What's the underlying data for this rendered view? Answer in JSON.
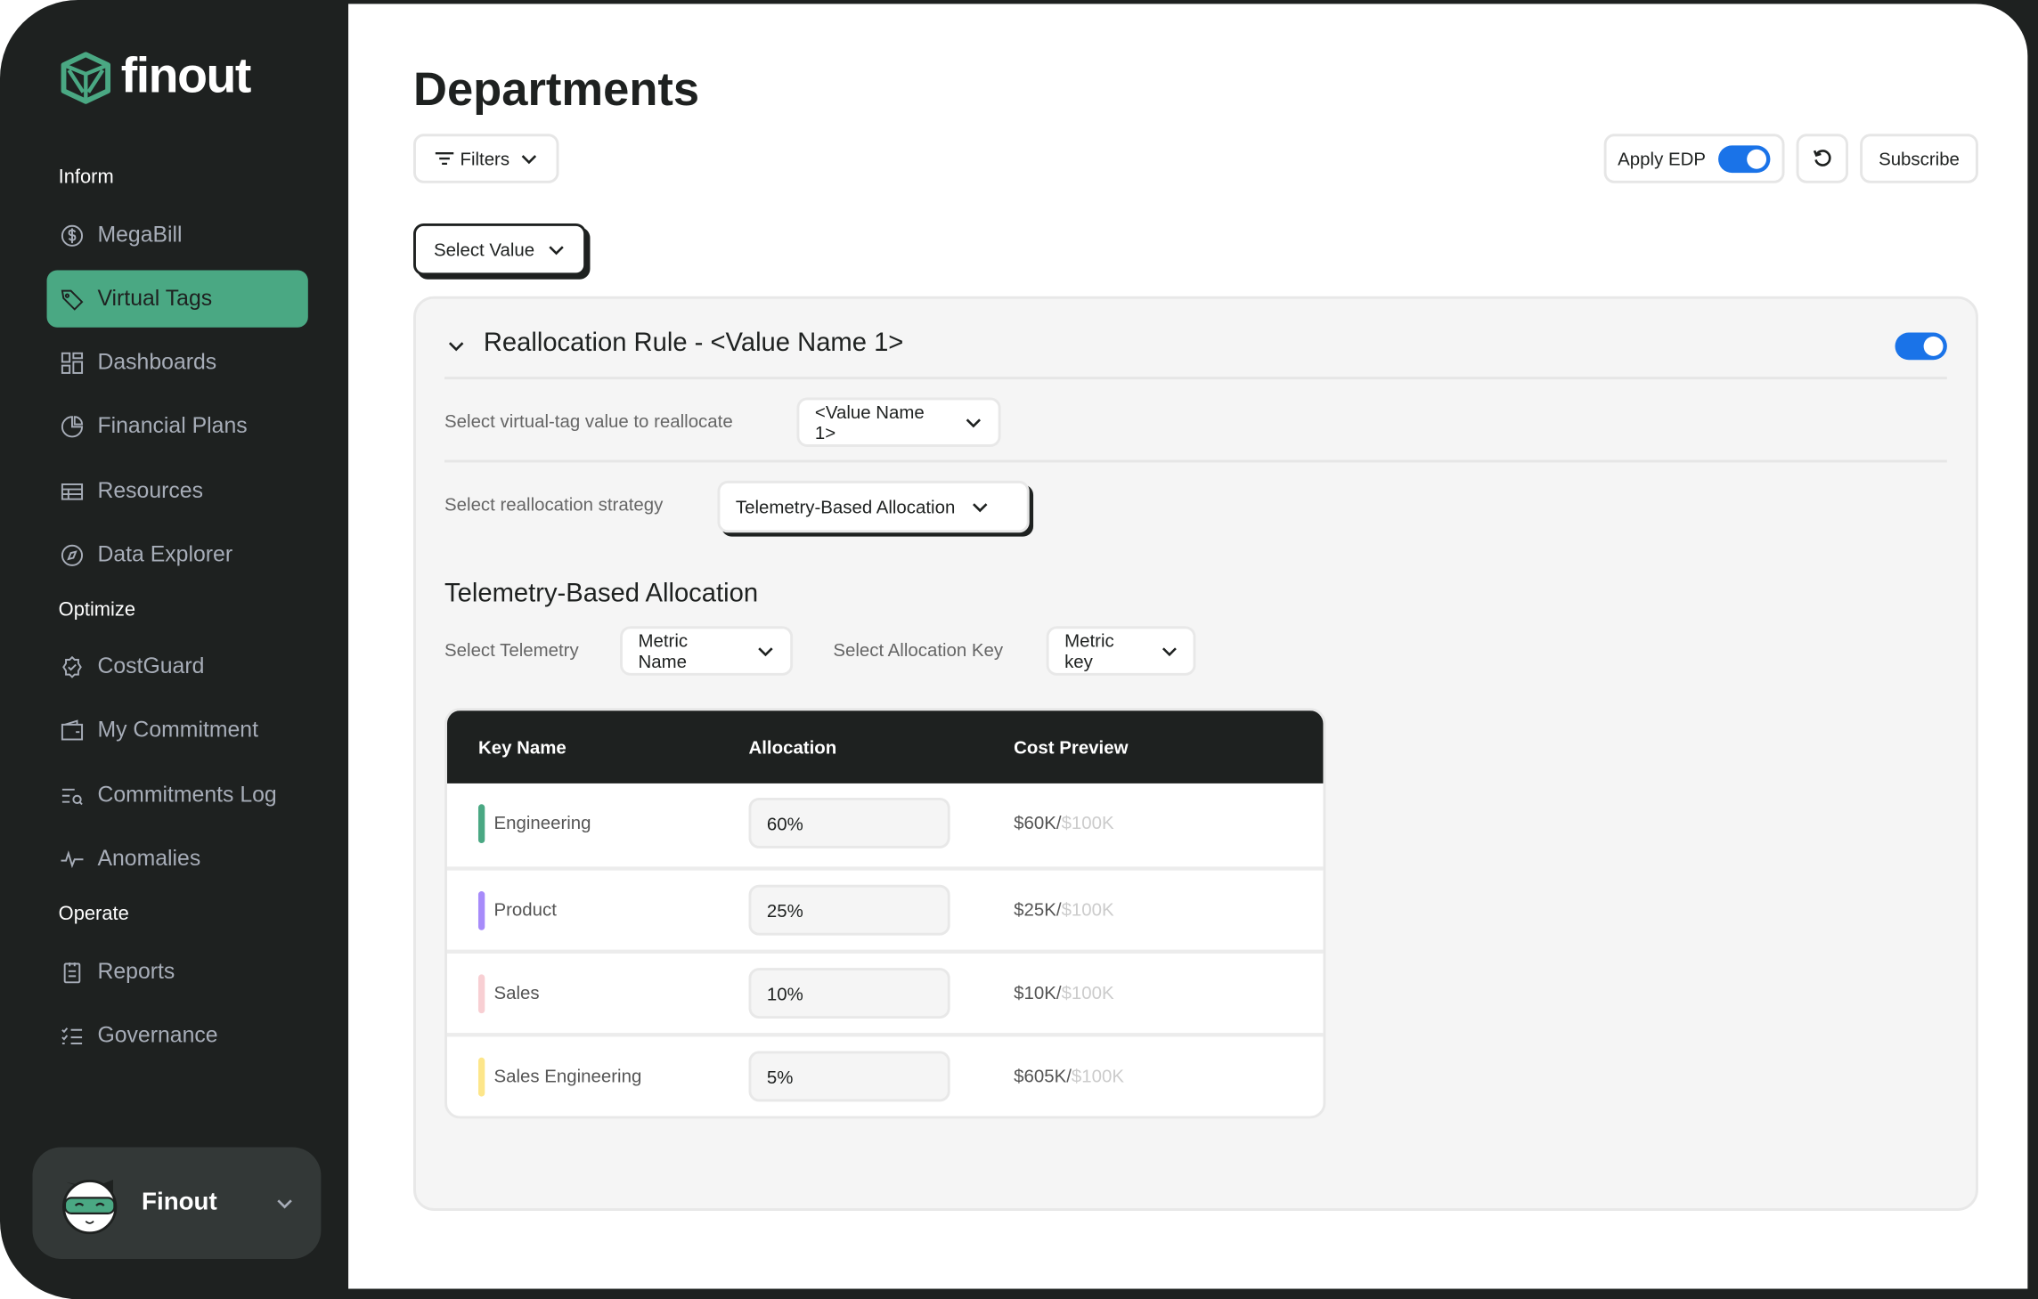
{
  "brand": {
    "name": "finout",
    "colors": {
      "accent": "#4aa883",
      "toggle": "#1a73e8",
      "sidebar": "#1e2120"
    }
  },
  "sidebar": {
    "sections": [
      {
        "label": "Inform",
        "items": [
          {
            "label": "MegaBill",
            "icon": "dollar-circle-icon"
          },
          {
            "label": "Virtual Tags",
            "icon": "tag-icon",
            "active": true
          },
          {
            "label": "Dashboards",
            "icon": "dashboard-icon"
          },
          {
            "label": "Financial Plans",
            "icon": "pie-chart-icon"
          },
          {
            "label": "Resources",
            "icon": "table-icon"
          },
          {
            "label": "Data Explorer",
            "icon": "compass-icon"
          }
        ]
      },
      {
        "label": "Optimize",
        "items": [
          {
            "label": "CostGuard",
            "icon": "badge-check-icon"
          },
          {
            "label": "My Commitment",
            "icon": "wallet-icon"
          },
          {
            "label": "Commitments Log",
            "icon": "list-search-icon"
          },
          {
            "label": "Anomalies",
            "icon": "pulse-icon"
          }
        ]
      },
      {
        "label": "Operate",
        "items": [
          {
            "label": "Reports",
            "icon": "clipboard-icon"
          },
          {
            "label": "Governance",
            "icon": "checklist-icon"
          }
        ]
      }
    ],
    "profile": {
      "name": "Finout"
    }
  },
  "header": {
    "title": "Departments",
    "filters_label": "Filters",
    "apply_edp_label": "Apply EDP",
    "apply_edp_on": true,
    "subscribe_label": "Subscribe",
    "select_value_label": "Select Value"
  },
  "rule": {
    "title": "Reallocation Rule - <Value Name 1>",
    "enabled": true,
    "value_label": "Select virtual-tag value to reallocate",
    "value_selected": "<Value Name 1>",
    "strategy_label": "Select reallocation strategy",
    "strategy_selected": "Telemetry-Based Allocation",
    "section_title": "Telemetry-Based Allocation",
    "telemetry_label": "Select Telemetry",
    "telemetry_selected": "Metric Name",
    "key_label": "Select Allocation Key",
    "key_selected": "Metric key"
  },
  "table": {
    "columns": [
      "Key Name",
      "Allocation",
      "Cost Preview"
    ],
    "rows": [
      {
        "key": "Engineering",
        "allocation": "60%",
        "cost": "$60K/",
        "total": "$100K",
        "color": "#4aa883"
      },
      {
        "key": "Product",
        "allocation": "25%",
        "cost": "$25K/",
        "total": "$100K",
        "color": "#a78bfa"
      },
      {
        "key": "Sales",
        "allocation": "10%",
        "cost": "$10K/",
        "total": "$100K",
        "color": "#f8cfd3"
      },
      {
        "key": "Sales Engineering",
        "allocation": "5%",
        "cost": "$605K/",
        "total": "$100K",
        "color": "#fde68a"
      }
    ]
  }
}
